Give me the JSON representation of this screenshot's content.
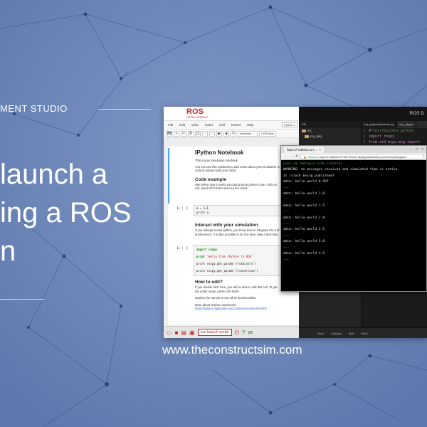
{
  "brand": {
    "studio_label": "MENT STUDIO",
    "title_lines": [
      "launch a",
      "ing a ROS",
      "n"
    ],
    "url": "www.theconstructsim.com"
  },
  "colors": {
    "background": "#6b86b8",
    "accent_red": "#c62828",
    "terminal_bg": "#000000",
    "ide_bg": "#1e1e1e"
  },
  "jupyter": {
    "logo": "ROS",
    "logo_sub": "DEVELOPMENT",
    "menu": [
      "File",
      "Edit",
      "View",
      "Insert",
      "Cell",
      "Kernel",
      "Help"
    ],
    "kernel_label": "Python 2",
    "toolbar": {
      "buttons": [
        "💾",
        "+",
        "✂",
        "⎘",
        "📋",
        "↑",
        "↓",
        "▶",
        "■",
        "↻"
      ],
      "cell_type": "Markdown",
      "celltoolbar": "CellToolbar"
    },
    "intro": {
      "title": "IPython Notebook",
      "p1": "This is your simulation notebook.",
      "p2": "You can use this notebook to add notes about your simulation or",
      "p3": "code to interact with your robot."
    },
    "example": {
      "title": "Code example",
      "p1": "See below how it works executing some python code. Click on",
      "p2": "cell, press Ctrl+Enter and see the result."
    },
    "cell1": {
      "prompt": "In [ ]:",
      "lines": [
        "a = 1+1",
        "print a"
      ]
    },
    "interact": {
      "title": "Interact with your simulation",
      "p1": "If you already knows python, you know how to integrate it to a R",
      "p2": "environment. It is also possible to do it in here, take a look belo"
    },
    "cell2": {
      "prompt": "In [ ]:",
      "import_line": "import rospy",
      "print1_kw": "print",
      "print1_str": "'Hello from IPython to ROS'",
      "print2": "print rospy.get_param('/rosdistro')",
      "print3": "print rospy.get_param('/rosversion')"
    },
    "howto": {
      "title": "How to edit?",
      "p1": "If you double-click here, you will be able to edit this cell. To get",
      "p2": "the editor mode, press Ctrl+Enter.",
      "p3": "Explore the top bar to use all its functionalities.",
      "p4": "More about IPython notebooks:",
      "link": "https://jupyter.org/jupyter-doc/2/interactive/tutorial.html"
    },
    "bottom_bar": {
      "launch_label": "ros launch script"
    }
  },
  "ide": {
    "title": "ROS D",
    "tree_header": "ros",
    "tree": [
      "src",
      "my_pkg"
    ],
    "tabs": [
      "/my_pkg/scripts/main.py",
      "/my_pkg/sc"
    ],
    "code": [
      {
        "n": "1",
        "text": "#!/usr/bin/env python",
        "cls": "cm"
      },
      {
        "n": "2",
        "text": "import rospy",
        "cls": "kw2"
      },
      {
        "n": "3",
        "text": "from std_msgs.msg import",
        "cls": "kw2"
      }
    ],
    "status": [
      "Save",
      "Settings",
      "Split",
      "Wind"
    ]
  },
  "browser": {
    "tab_title": "https://i-0d8b51227...",
    "secure_label": "Secure",
    "url": "https://i-0d8b5122790e71541.robotignite­academy.com/cloud9/jupyter...",
    "terminal_lines": [
      {
        "text": "user:~$ rostopic echo /chatter",
        "cls": "t-prompt"
      },
      {
        "text": "WARNING: no messages received and simulated time is active.",
        "cls": "t-warn"
      },
      {
        "text": "Is /clock being published?",
        "cls": "t-warn"
      },
      {
        "text": "data: hello world 0.597",
        "cls": ""
      },
      {
        "text": "---",
        "cls": ""
      },
      {
        "text": "data: hello world 1.0",
        "cls": ""
      },
      {
        "text": "---",
        "cls": ""
      },
      {
        "text": "data: hello world 1.5",
        "cls": ""
      },
      {
        "text": "---",
        "cls": ""
      },
      {
        "text": "data: hello world 2.0",
        "cls": ""
      },
      {
        "text": "---",
        "cls": ""
      },
      {
        "text": "data: hello world 2.5",
        "cls": ""
      },
      {
        "text": "---",
        "cls": ""
      },
      {
        "text": "data: hello world 3.0",
        "cls": ""
      },
      {
        "text": "---",
        "cls": ""
      },
      {
        "text": "data: hello world 3.5",
        "cls": ""
      },
      {
        "text": "---",
        "cls": ""
      }
    ]
  }
}
